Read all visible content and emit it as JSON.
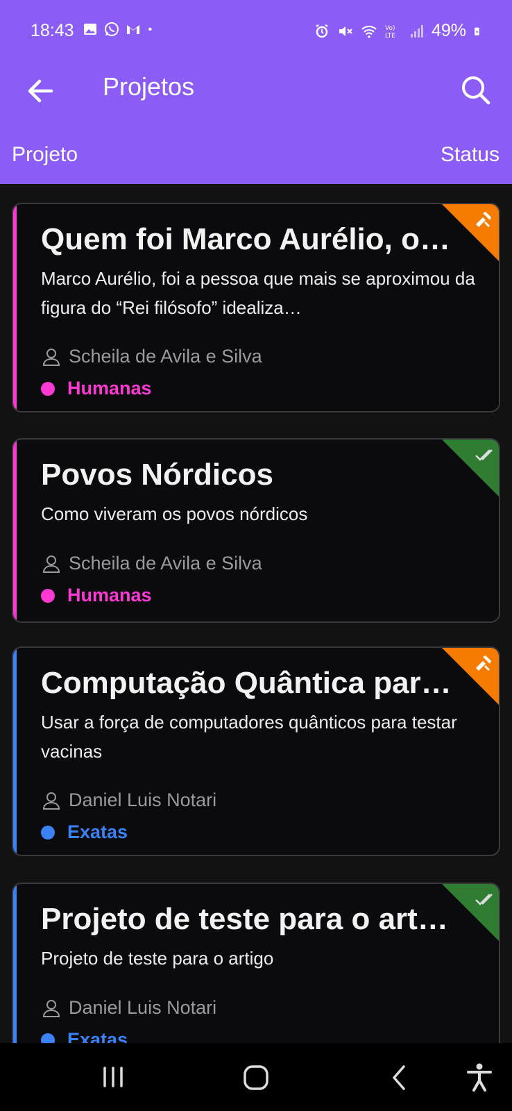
{
  "status_bar": {
    "time": "18:43",
    "left_icons": [
      "gallery-icon",
      "whatsapp-icon",
      "gmail-icon",
      "dot-icon"
    ],
    "right_icons": [
      "alarm-icon",
      "mute-icon",
      "wifi-icon",
      "volte-icon",
      "signal-icon"
    ],
    "battery": "49%"
  },
  "appbar": {
    "title": "Projetos",
    "columns": {
      "project": "Projeto",
      "status": "Status"
    }
  },
  "colors": {
    "header": "#8b5cf6",
    "humanas": "#ff3ad2",
    "exatas": "#3b82f6",
    "status_in_progress": "#f57c00",
    "status_done": "#2e7d32"
  },
  "projects": [
    {
      "title": "Quem foi Marco Aurélio, o…",
      "description": "Marco Aurélio, foi a pessoa que mais se aproximou da figura do “Rei filósofo” idealiza…",
      "author": "Scheila de Avila e Silva",
      "area": "Humanas",
      "status_icon": "construction-icon"
    },
    {
      "title": "Povos Nórdicos",
      "description": "Como viveram os povos nórdicos",
      "author": "Scheila de Avila e Silva",
      "area": "Humanas",
      "status_icon": "done-all-icon"
    },
    {
      "title": "Computação Quântica par…",
      "description": "Usar a força de computadores quânticos para testar vacinas",
      "author": "Daniel Luis Notari",
      "area": "Exatas",
      "status_icon": "construction-icon"
    },
    {
      "title": "Projeto de teste para o art…",
      "description": "Projeto de teste para o artigo",
      "author": "Daniel Luis Notari",
      "area": "Exatas",
      "status_icon": "done-all-icon"
    }
  ]
}
